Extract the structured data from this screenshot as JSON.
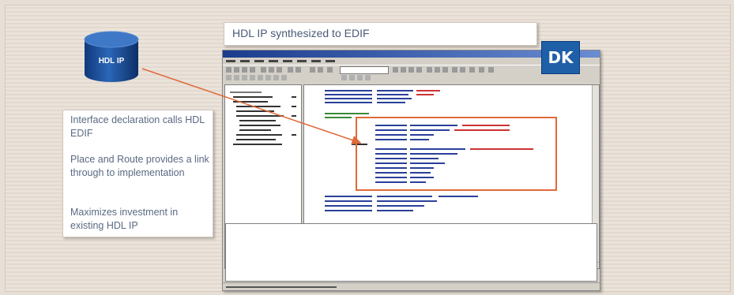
{
  "database": {
    "label": "HDL IP"
  },
  "callouts": {
    "title": "HDL IP synthesized to EDIF",
    "bullets": [
      "Interface declaration calls HDL EDIF",
      "Place and Route provides a link through to implementation",
      "Maximizes investment in existing HDL IP"
    ]
  },
  "logo": {
    "text": "DK"
  },
  "colors": {
    "accent": "#e06a3a",
    "logo_bg": "#1f5fa8",
    "db_blue": "#1d4e9a"
  }
}
